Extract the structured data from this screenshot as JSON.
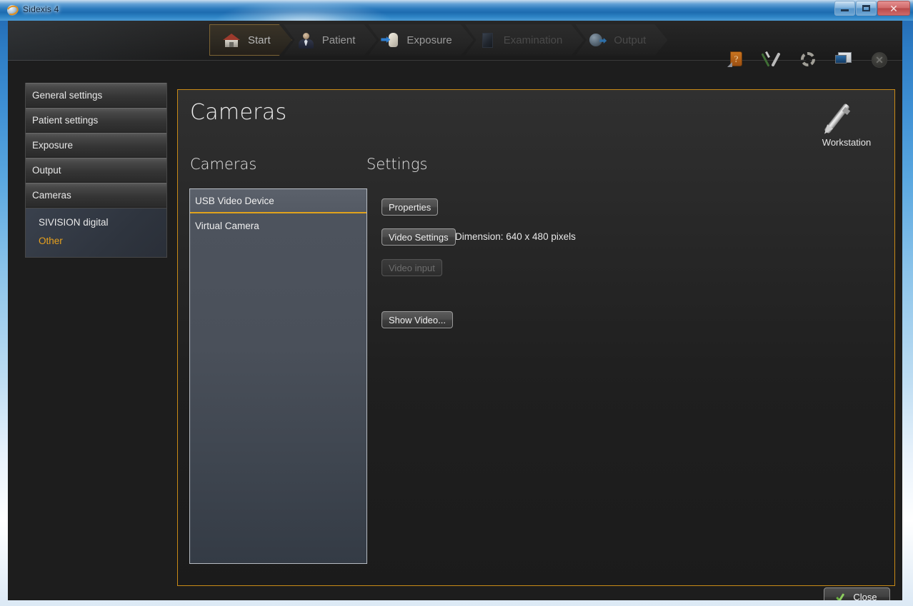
{
  "window": {
    "title": "Sidexis 4",
    "app_icon": "sidexis-globe-icon",
    "controls": {
      "minimize": "minimize-button",
      "maximize": "restore-button",
      "close": "close-window-button",
      "close_glyph": "✕"
    }
  },
  "topnav": {
    "steps": [
      {
        "label": "Start",
        "icon": "house-icon",
        "state": "active"
      },
      {
        "label": "Patient",
        "icon": "person-icon",
        "state": "normal"
      },
      {
        "label": "Exposure",
        "icon": "tooth-arrow-icon",
        "state": "normal"
      },
      {
        "label": "Examination",
        "icon": "film-plate-icon",
        "state": "disabled"
      },
      {
        "label": "Output",
        "icon": "globe-arrow-icon",
        "state": "disabled"
      }
    ],
    "tools": [
      {
        "name": "help-book-icon",
        "glyph": "?"
      },
      {
        "name": "service-tools-icon"
      },
      {
        "name": "gear-settings-icon"
      },
      {
        "name": "display-monitor-icon"
      },
      {
        "name": "cancel-circle-icon",
        "glyph": "✕"
      }
    ]
  },
  "sidebar": {
    "headers": [
      {
        "label": "General settings"
      },
      {
        "label": "Patient settings"
      },
      {
        "label": "Exposure"
      },
      {
        "label": "Output"
      },
      {
        "label": "Cameras"
      }
    ],
    "subitems": [
      {
        "label": "SIVISION digital",
        "selected": false
      },
      {
        "label": "Other",
        "selected": true
      }
    ]
  },
  "main": {
    "page_title": "Cameras",
    "workstation_label": "Workstation",
    "workstation_icon": "stylus-pen-icon",
    "cameras_section_title": "Cameras",
    "settings_section_title": "Settings",
    "camera_list": [
      {
        "label": "USB Video Device",
        "selected": true
      },
      {
        "label": "Virtual Camera",
        "selected": false
      }
    ],
    "buttons": {
      "properties": "Properties",
      "video_settings": "Video Settings",
      "video_input": "Video input",
      "show_video": "Show Video..."
    },
    "dimension_text": "Dimension: 640 x 480 pixels"
  },
  "footer": {
    "close_label": "Close",
    "close_icon": "green-check-icon"
  },
  "colors": {
    "accent_orange": "#e0a21c",
    "panel_border": "#c98a16",
    "selected_text": "#e8a11d",
    "aero_blue": "#2d7cc4"
  }
}
